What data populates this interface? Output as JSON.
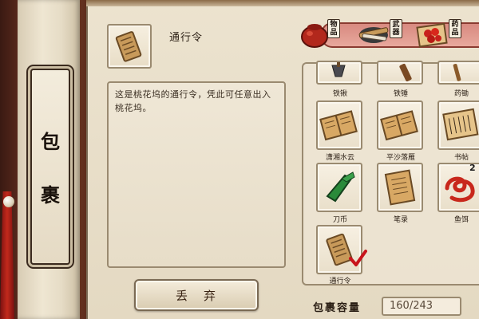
{
  "sidebar": {
    "title_chars": [
      "包",
      "裹"
    ]
  },
  "detail": {
    "item_name": "通行令",
    "description": "这是桃花坞的通行令，凭此可任意出入桃花坞。",
    "discard_chars": [
      "丢",
      "弃"
    ]
  },
  "tabs": [
    {
      "badge": "物\n品",
      "icon": "pot-icon"
    },
    {
      "badge": "武\n器",
      "icon": "weapon-bundle-icon"
    },
    {
      "badge": "药\n品",
      "icon": "fruit-plate-icon"
    }
  ],
  "inventory": {
    "slots": [
      {
        "label": "铁锹",
        "icon": "shovel-icon"
      },
      {
        "label": "铁锤",
        "icon": "hammer-icon"
      },
      {
        "label": "药锄",
        "icon": "hoe-icon"
      },
      {
        "label": "潇湘水云",
        "icon": "book-icon"
      },
      {
        "label": "平沙落雁",
        "icon": "book-icon"
      },
      {
        "label": "书帖",
        "icon": "scroll-icon"
      },
      {
        "label": "刀币",
        "icon": "knife-coin-icon"
      },
      {
        "label": "笔录",
        "icon": "paper-icon"
      },
      {
        "label": "鱼饵",
        "icon": "worm-bait-icon"
      },
      {
        "label": "通行令",
        "icon": "pass-token-icon",
        "selected": true
      }
    ],
    "bait_count": "2"
  },
  "capacity": {
    "label": "包裹容量",
    "value": "160/243"
  },
  "colors": {
    "parchment": "#ece3cf",
    "frame": "#9a8a70",
    "tab_band": "#e8a89c",
    "check_red": "#c8141c"
  }
}
